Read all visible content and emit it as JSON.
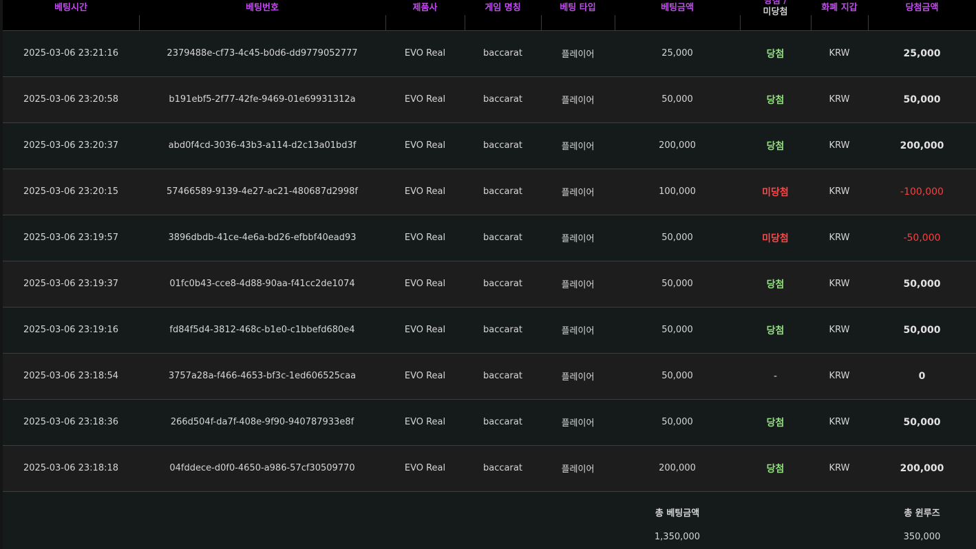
{
  "columns": [
    "베팅시간",
    "베팅번호",
    "제품사",
    "게임 명칭",
    "베팅 타입",
    "베팅금액",
    "당첨 /",
    "미당첨",
    "화폐 지갑",
    "당첨금액"
  ],
  "rows": [
    {
      "time": "2025-03-06 23:21:16",
      "id": "2379488e-cf73-4c45-b0d6-dd9779052777",
      "provider": "EVO Real",
      "game": "baccarat",
      "bet_type": "플레이어",
      "bet_amount": "25,000",
      "result": "당첨",
      "result_type": "win",
      "currency": "KRW",
      "win_amount": "25,000"
    },
    {
      "time": "2025-03-06 23:20:58",
      "id": "b191ebf5-2f77-42fe-9469-01e69931312a",
      "provider": "EVO Real",
      "game": "baccarat",
      "bet_type": "플레이어",
      "bet_amount": "50,000",
      "result": "당첨",
      "result_type": "win",
      "currency": "KRW",
      "win_amount": "50,000"
    },
    {
      "time": "2025-03-06 23:20:37",
      "id": "abd0f4cd-3036-43b3-a114-d2c13a01bd3f",
      "provider": "EVO Real",
      "game": "baccarat",
      "bet_type": "플레이어",
      "bet_amount": "200,000",
      "result": "당첨",
      "result_type": "win",
      "currency": "KRW",
      "win_amount": "200,000"
    },
    {
      "time": "2025-03-06 23:20:15",
      "id": "57466589-9139-4e27-ac21-480687d2998f",
      "provider": "EVO Real",
      "game": "baccarat",
      "bet_type": "플레이어",
      "bet_amount": "100,000",
      "result": "미당첨",
      "result_type": "lose",
      "currency": "KRW",
      "win_amount": "-100,000"
    },
    {
      "time": "2025-03-06 23:19:57",
      "id": "3896dbdb-41ce-4e6a-bd26-efbbf40ead93",
      "provider": "EVO Real",
      "game": "baccarat",
      "bet_type": "플레이어",
      "bet_amount": "50,000",
      "result": "미당첨",
      "result_type": "lose",
      "currency": "KRW",
      "win_amount": "-50,000"
    },
    {
      "time": "2025-03-06 23:19:37",
      "id": "01fc0b43-cce8-4d88-90aa-f41cc2de1074",
      "provider": "EVO Real",
      "game": "baccarat",
      "bet_type": "플레이어",
      "bet_amount": "50,000",
      "result": "당첨",
      "result_type": "win",
      "currency": "KRW",
      "win_amount": "50,000"
    },
    {
      "time": "2025-03-06 23:19:16",
      "id": "fd84f5d4-3812-468c-b1e0-c1bbefd680e4",
      "provider": "EVO Real",
      "game": "baccarat",
      "bet_type": "플레이어",
      "bet_amount": "50,000",
      "result": "당첨",
      "result_type": "win",
      "currency": "KRW",
      "win_amount": "50,000"
    },
    {
      "time": "2025-03-06 23:18:54",
      "id": "3757a28a-f466-4653-bf3c-1ed606525caa",
      "provider": "EVO Real",
      "game": "baccarat",
      "bet_type": "플레이어",
      "bet_amount": "50,000",
      "result": "-",
      "result_type": "none",
      "currency": "KRW",
      "win_amount": "0"
    },
    {
      "time": "2025-03-06 23:18:36",
      "id": "266d504f-da7f-408e-9f90-940787933e8f",
      "provider": "EVO Real",
      "game": "baccarat",
      "bet_type": "플레이어",
      "bet_amount": "50,000",
      "result": "당첨",
      "result_type": "win",
      "currency": "KRW",
      "win_amount": "50,000"
    },
    {
      "time": "2025-03-06 23:18:18",
      "id": "04fddece-d0f0-4650-a986-57cf30509770",
      "provider": "EVO Real",
      "game": "baccarat",
      "bet_type": "플레이어",
      "bet_amount": "200,000",
      "result": "당첨",
      "result_type": "win",
      "currency": "KRW",
      "win_amount": "200,000"
    }
  ],
  "footer": {
    "total_bet_label": "총 베팅금액",
    "total_bet_value": "1,350,000",
    "total_winloss_label": "총 윈루즈",
    "total_winloss_value": "350,000"
  },
  "colors": {
    "header_text": "#c24cf0",
    "win": "#8fe07c",
    "lose": "#ff4545",
    "background": "#141616"
  }
}
